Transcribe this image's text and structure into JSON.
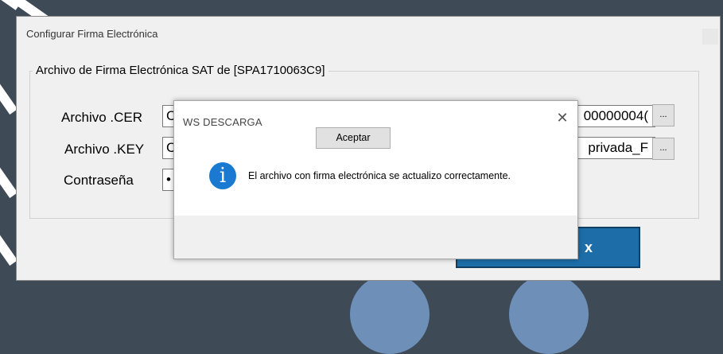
{
  "main_window": {
    "title": "Configurar Firma Electrónica",
    "group_title": "Archivo de Firma Electrónica SAT de [SPA1710063C9]",
    "fields": {
      "cer": {
        "label": "Archivo .CER",
        "value_left": "C",
        "value_right": "00000004("
      },
      "key": {
        "label": "Archivo .KEY",
        "value_left": "C",
        "value_right": "privada_F"
      },
      "password": {
        "label": "Contraseña",
        "value_left": "•"
      }
    },
    "browse_label": "...",
    "action_button_fragment": "x"
  },
  "message_box": {
    "title": "WS DESCARGA",
    "close_glyph": "✕",
    "icon_glyph": "i",
    "message": "El archivo con firma electrónica se actualizo correctamente.",
    "ok_label": "Aceptar"
  },
  "colors": {
    "info_icon": "#1a79d1",
    "action_button": "#1d6ea8",
    "desktop_background": "#3f4a57"
  }
}
